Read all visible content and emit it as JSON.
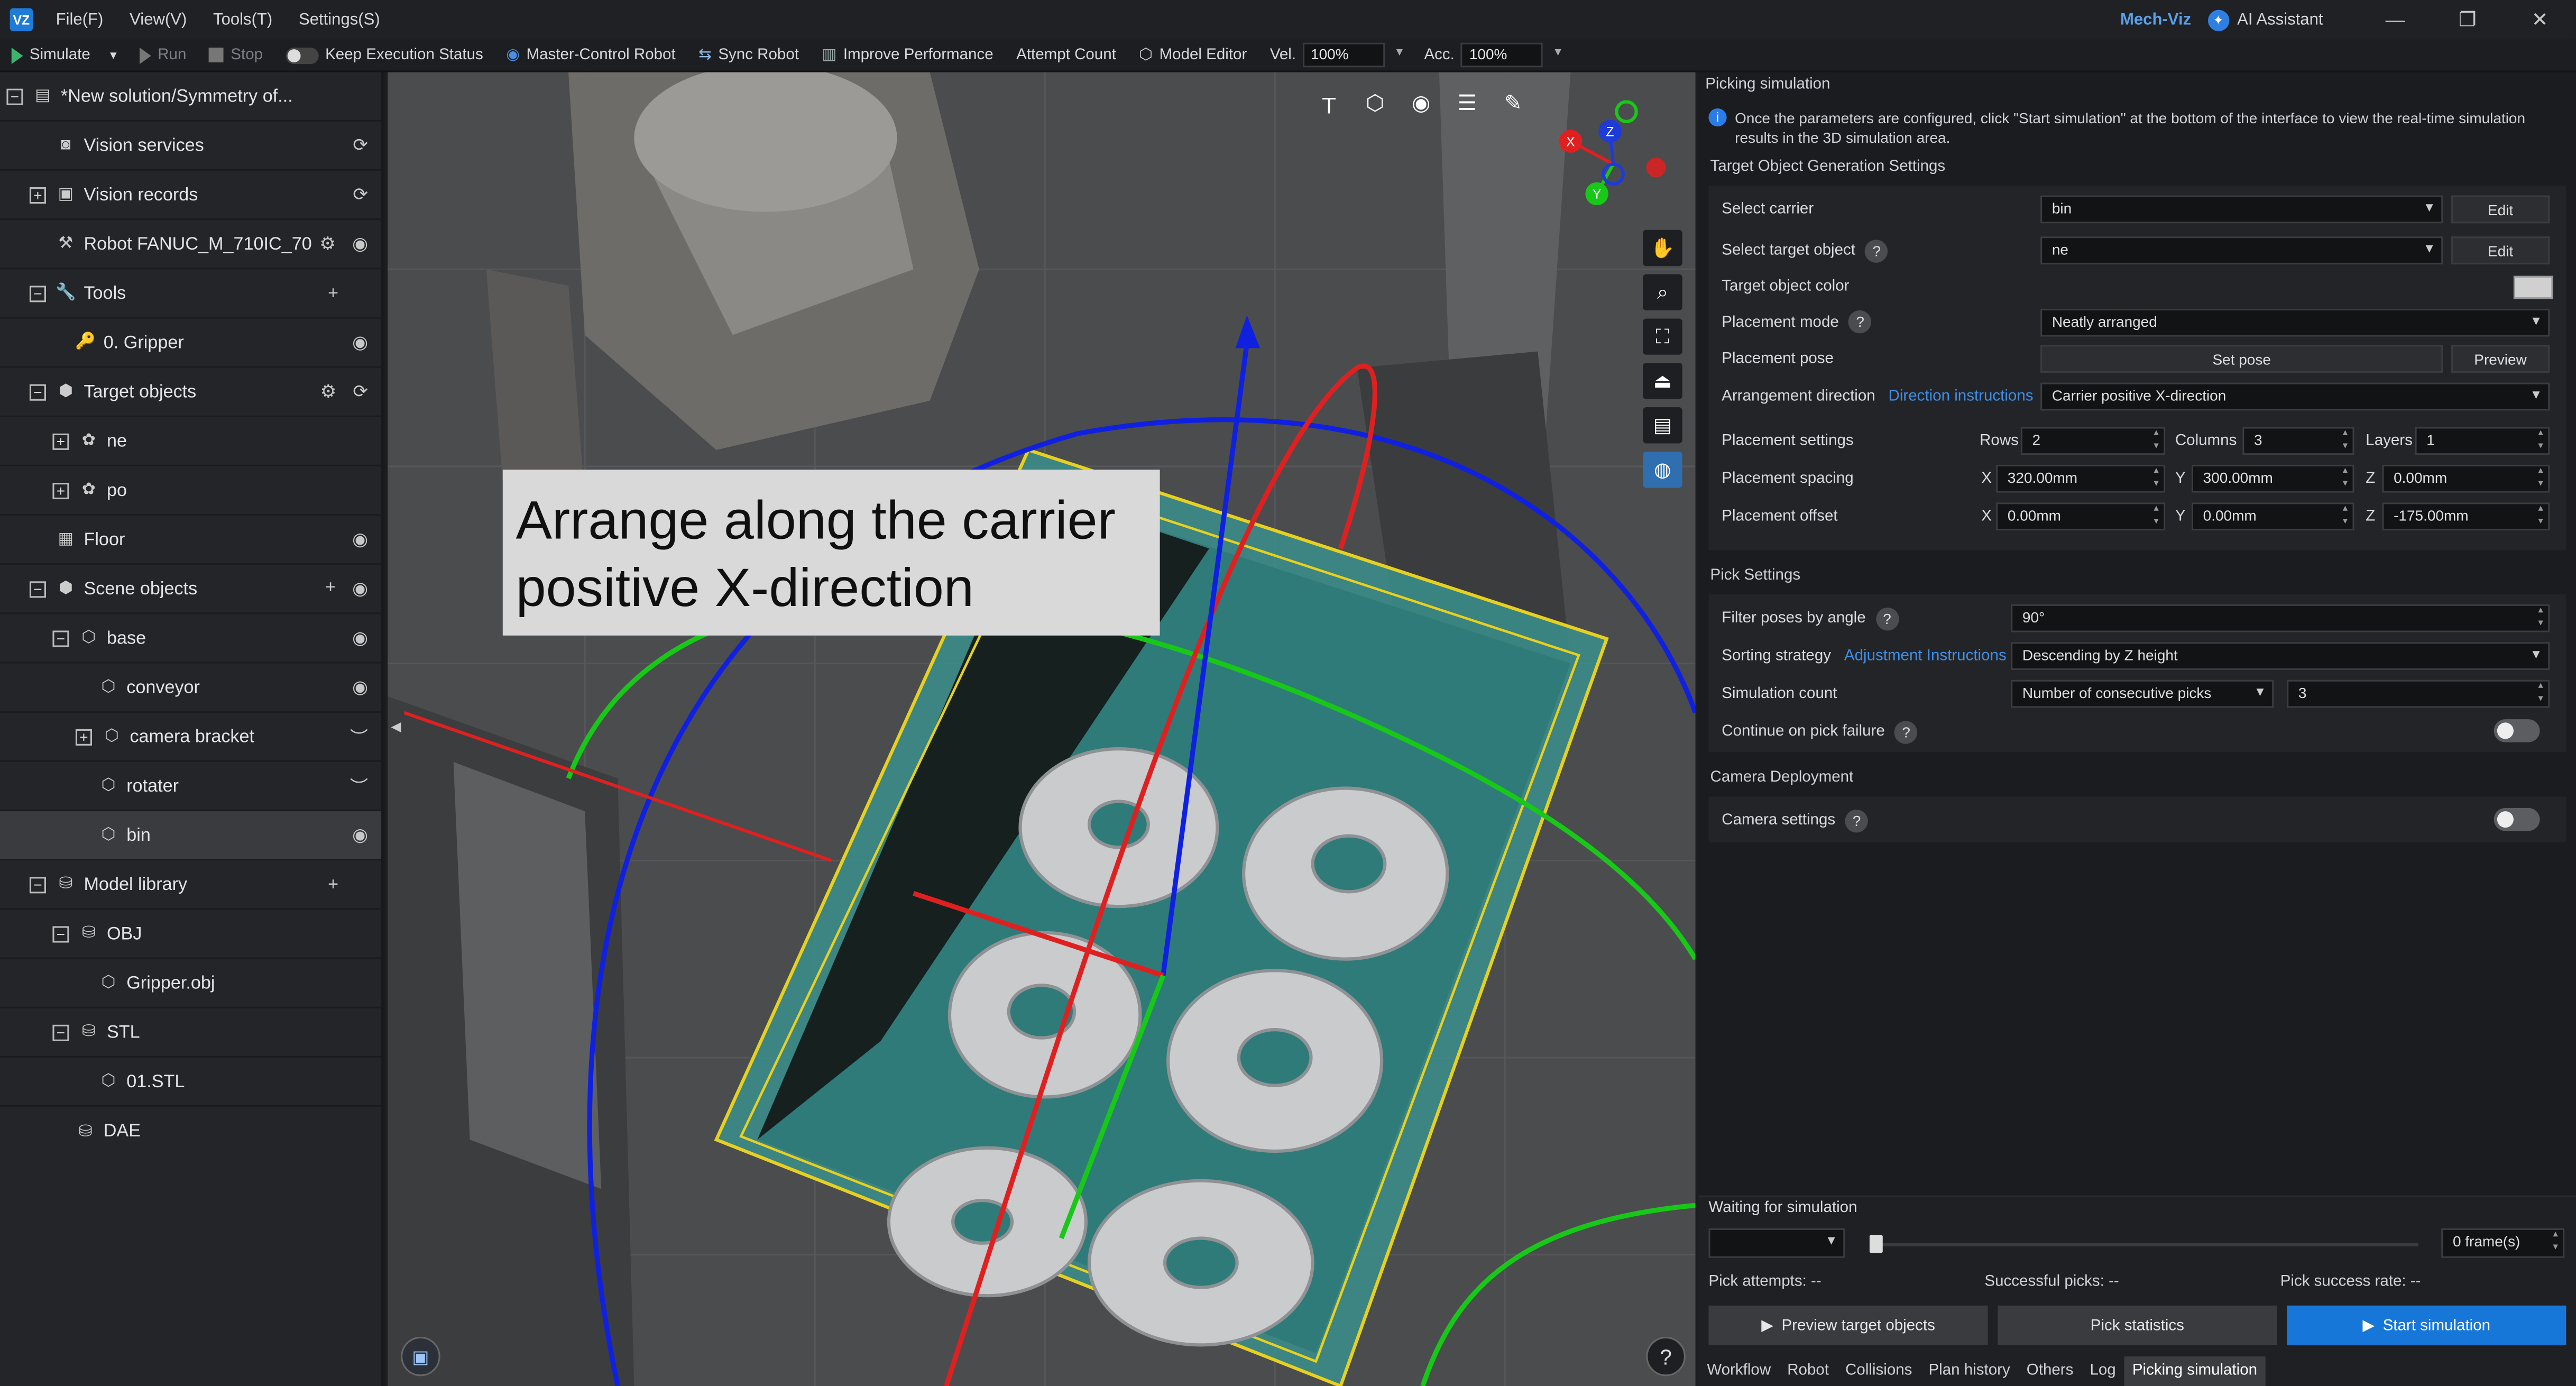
{
  "app": {
    "logo_text": "VZ",
    "name": "Mech-Viz",
    "ai_assistant": "AI Assistant",
    "menu": [
      "File(F)",
      "View(V)",
      "Tools(T)",
      "Settings(S)"
    ]
  },
  "toolbar": {
    "simulate": "Simulate",
    "run": "Run",
    "stop": "Stop",
    "keep_status": "Keep Execution Status",
    "master_control": "Master-Control Robot",
    "sync_robot": "Sync Robot",
    "improve_performance": "Improve Performance",
    "attempt_count": "Attempt Count",
    "model_editor": "Model Editor",
    "vel_label": "Vel.",
    "vel_value": "100%",
    "acc_label": "Acc.",
    "acc_value": "100%"
  },
  "tree": {
    "solution": "*New solution/Symmetry of...",
    "vision_services": "Vision services",
    "vision_records": "Vision records",
    "robot": "Robot FANUC_M_710IC_70",
    "tools": "Tools",
    "gripper": "0. Gripper",
    "target_objects": "Target objects",
    "ne": "ne",
    "po": "po",
    "floor": "Floor",
    "scene_objects": "Scene objects",
    "base": "base",
    "conveyor": "conveyor",
    "camera_bracket": "camera bracket",
    "rotater": "rotater",
    "bin": "bin",
    "model_library": "Model library",
    "obj": "OBJ",
    "gripper_obj": "Gripper.obj",
    "stl": "STL",
    "stl_file": "01.STL",
    "dae": "DAE"
  },
  "viewport": {
    "callout": "Arrange along the carrier positive X-direction",
    "axis_x": "X",
    "axis_y": "Y",
    "axis_z": "Z",
    "help": "?"
  },
  "panel": {
    "title": "Picking simulation",
    "info": "Once the parameters are configured, click \"Start simulation\" at the bottom of the interface to view the real-time simulation results in the 3D simulation area.",
    "target_section": "Target Object Generation Settings",
    "select_carrier_label": "Select carrier",
    "select_carrier_value": "bin",
    "edit": "Edit",
    "select_target_label": "Select target object",
    "select_target_value": "ne",
    "target_color_label": "Target object color",
    "placement_mode_label": "Placement mode",
    "placement_mode_value": "Neatly arranged",
    "placement_pose_label": "Placement pose",
    "set_pose": "Set pose",
    "preview": "Preview",
    "arrangement_label": "Arrangement direction",
    "direction_link": "Direction instructions",
    "arrangement_value": "Carrier positive X-direction",
    "placement_settings_label": "Placement settings",
    "rows_label": "Rows",
    "rows_value": "2",
    "columns_label": "Columns",
    "columns_value": "3",
    "layers_label": "Layers",
    "layers_value": "1",
    "spacing_label": "Placement spacing",
    "spacing_x": "320.00mm",
    "spacing_y": "300.00mm",
    "spacing_z": "0.00mm",
    "offset_label": "Placement offset",
    "offset_x": "0.00mm",
    "offset_y": "0.00mm",
    "offset_z": "-175.00mm",
    "x": "X",
    "y": "Y",
    "z": "Z",
    "pick_section": "Pick Settings",
    "filter_label": "Filter poses by angle",
    "filter_value": "90°",
    "sorting_label": "Sorting strategy",
    "sorting_link": "Adjustment Instructions",
    "sorting_value": "Descending by Z height",
    "sim_count_label": "Simulation count",
    "sim_count_mode": "Number of consecutive picks",
    "sim_count_value": "3",
    "continue_label": "Continue on pick failure",
    "camera_section": "Camera Deployment",
    "camera_settings_label": "Camera settings",
    "waiting": "Waiting for simulation",
    "frames": "0 frame(s)",
    "pick_attempts": "Pick attempts:  --",
    "successful_picks": "Successful picks:  --",
    "pick_success_rate": "Pick success rate:  --",
    "preview_btn": "Preview target objects",
    "statistics_btn": "Pick statistics",
    "start_btn": "Start simulation",
    "tabs": [
      "Workflow",
      "Robot",
      "Collisions",
      "Plan history",
      "Others",
      "Log",
      "Picking simulation"
    ]
  },
  "colors": {
    "accent": "#1677d9",
    "link": "#3f8fe8",
    "run_green": "#3db46d",
    "axis_red": "#e02020",
    "axis_green": "#18c818",
    "axis_blue": "#1020e0",
    "bin_outline": "#e8d020",
    "bin_fill": "#3f9e9a"
  },
  "icons": [
    "play-icon",
    "gear-icon",
    "refresh-icon",
    "eye-icon",
    "eye-closed-icon",
    "plus-icon",
    "hand-icon",
    "zoom-icon",
    "fit-icon",
    "help-icon",
    "info-icon"
  ]
}
